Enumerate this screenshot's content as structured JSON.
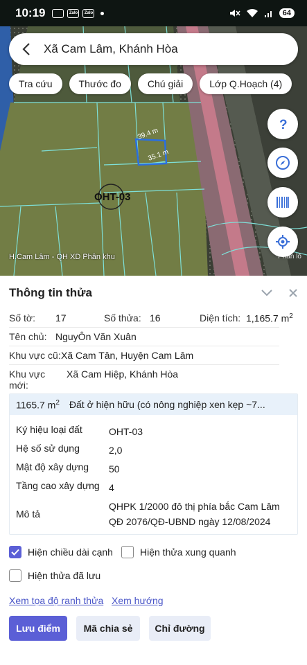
{
  "status": {
    "time": "10:19",
    "battery": "64",
    "app_icons": [
      "",
      "Zalo",
      "Zalo"
    ]
  },
  "search": {
    "text": "Xã Cam Lâm, Khánh Hòa"
  },
  "chips": [
    "Tra cứu",
    "Thước đo",
    "Chú giải",
    "Lớp Q.Hoạch (4)"
  ],
  "map": {
    "parcel_label": "OHT-03",
    "edge_labels": [
      "39.4 m",
      "35.1 m"
    ],
    "caption": "H.Cam Lâm - QH XD Phân khu",
    "caption_right": "Phân lô",
    "fab_icons": [
      "help-icon",
      "compass-icon",
      "barcode-icon",
      "my-location-icon"
    ]
  },
  "panel": {
    "title": "Thông tin thửa",
    "so_to_label": "Số tờ:",
    "so_to_value": "17",
    "so_thua_label": "Số thửa:",
    "so_thua_value": "16",
    "dien_tich_label": "Diện tích:",
    "dien_tich_value": "1,165.7 m",
    "dien_tich_unit_sup": "2",
    "ten_chu_label": "Tên chủ:",
    "ten_chu_value": "NguyÔn Văn Xuân",
    "kv_cu_label": "Khu vực cũ:",
    "kv_cu_value": "Xã Cam Tân, Huyện Cam Lâm",
    "kv_moi_label": "Khu vực mới:",
    "kv_moi_value": "Xã Cam Hiệp, Khánh Hòa"
  },
  "detail": {
    "area": "1165.7 m",
    "area_sup": "2",
    "purpose": "Đất ở hiện hữu (có nông nghiệp xen kẹp ~7...",
    "rows": [
      {
        "label": "Ký hiệu loại đất",
        "value": "OHT-03"
      },
      {
        "label": "Hệ số sử dụng",
        "value": "2,0"
      },
      {
        "label": "Mật độ xây dựng",
        "value": "50"
      },
      {
        "label": "Tầng cao xây dựng",
        "value": "4"
      },
      {
        "label": "Mô tả",
        "value": "QHPK 1/2000 đô thị phía bắc Cam Lâm QĐ 2076/QĐ-UBND ngày 12/08/2024"
      }
    ]
  },
  "options": {
    "show_edge_length": "Hiện chiều dài cạnh",
    "show_edge_length_checked": true,
    "show_neighbors": "Hiện thửa xung quanh",
    "show_neighbors_checked": false,
    "show_saved": "Hiện thửa đã lưu",
    "show_saved_checked": false
  },
  "links": {
    "coords": "Xem tọa độ ranh thửa",
    "direction": "Xem hướng"
  },
  "buttons": {
    "save": "Lưu điểm",
    "share": "Mã chia sẻ",
    "route": "Chỉ đường"
  },
  "colors": {
    "accent": "#5b5fd6",
    "link": "#4a56c8",
    "header_bg": "#e8f1fa",
    "map_parcel_line": "#7ee0d8"
  }
}
